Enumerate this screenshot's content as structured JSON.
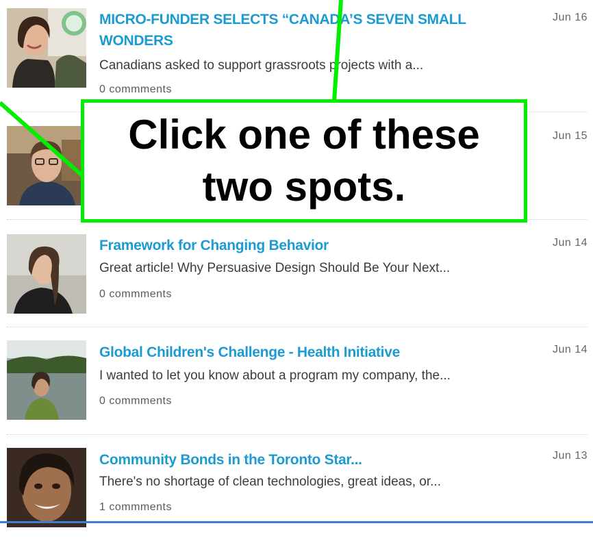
{
  "posts": [
    {
      "title": "MICRO-FUNDER SELECTS “CANADA’S SEVEN SMALL WONDERS",
      "excerpt": "Canadians asked to support grassroots projects with a...",
      "comments": "0 commments",
      "date": "Jun 16",
      "thumb_icon": "person-photo-icon"
    },
    {
      "title": "",
      "excerpt": "",
      "comments": "",
      "date": "Jun 15",
      "thumb_icon": "person-photo-icon"
    },
    {
      "title": "Framework for Changing Behavior",
      "excerpt": "Great article! Why Persuasive Design Should Be Your Next...",
      "comments": "0 commments",
      "date": "Jun 14",
      "thumb_icon": "person-photo-icon"
    },
    {
      "title": "Global Children's Challenge - Health Initiative",
      "excerpt": "I wanted to let you know about a program my company, the...",
      "comments": "0 commments",
      "date": "Jun 14",
      "thumb_icon": "person-photo-icon"
    },
    {
      "title": "Community Bonds in the Toronto Star...",
      "excerpt": "There's no shortage of clean technologies, great ideas, or...",
      "comments": "1 commments",
      "date": "Jun 13",
      "thumb_icon": "person-photo-icon"
    }
  ],
  "callout": {
    "line1": "Click one of these",
    "line2": "two spots."
  },
  "colors": {
    "title": "#1b9bd1",
    "highlight": "#00ee00",
    "excerpt": "#3c3c3c"
  }
}
